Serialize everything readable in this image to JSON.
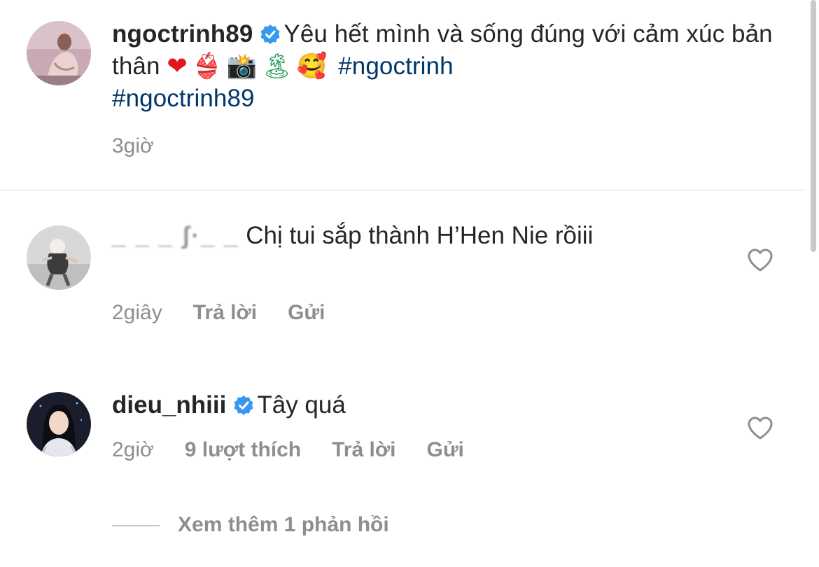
{
  "caption": {
    "username": "ngoctrinh89",
    "text": "Yêu hết mình và sống đúng với cảm xúc bản thân",
    "emojis": [
      "❤",
      "👙",
      "📸",
      "🏝",
      "🥰"
    ],
    "hashtags": [
      "#ngoctrinh",
      "#ngoctrinh89"
    ],
    "time": "3giờ"
  },
  "comments": [
    {
      "username_redacted": "_ _ _ ʃ·_ _",
      "text": "Chị tui sắp thành H’Hen Nie rồiii",
      "time": "2giây",
      "reply_label": "Trả lời",
      "send_label": "Gửi"
    },
    {
      "username": "dieu_nhiii",
      "text": "Tây quá",
      "time": "2giờ",
      "likes": "9 lượt thích",
      "reply_label": "Trả lời",
      "send_label": "Gửi",
      "view_replies": "Xem thêm 1 phản hồi"
    }
  ],
  "colors": {
    "hashtag": "#00376b",
    "verified": "#3897f0",
    "muted": "#8e8e8e",
    "text": "#262626"
  },
  "icons": [
    "verified-badge-icon",
    "heart-outline-icon"
  ]
}
